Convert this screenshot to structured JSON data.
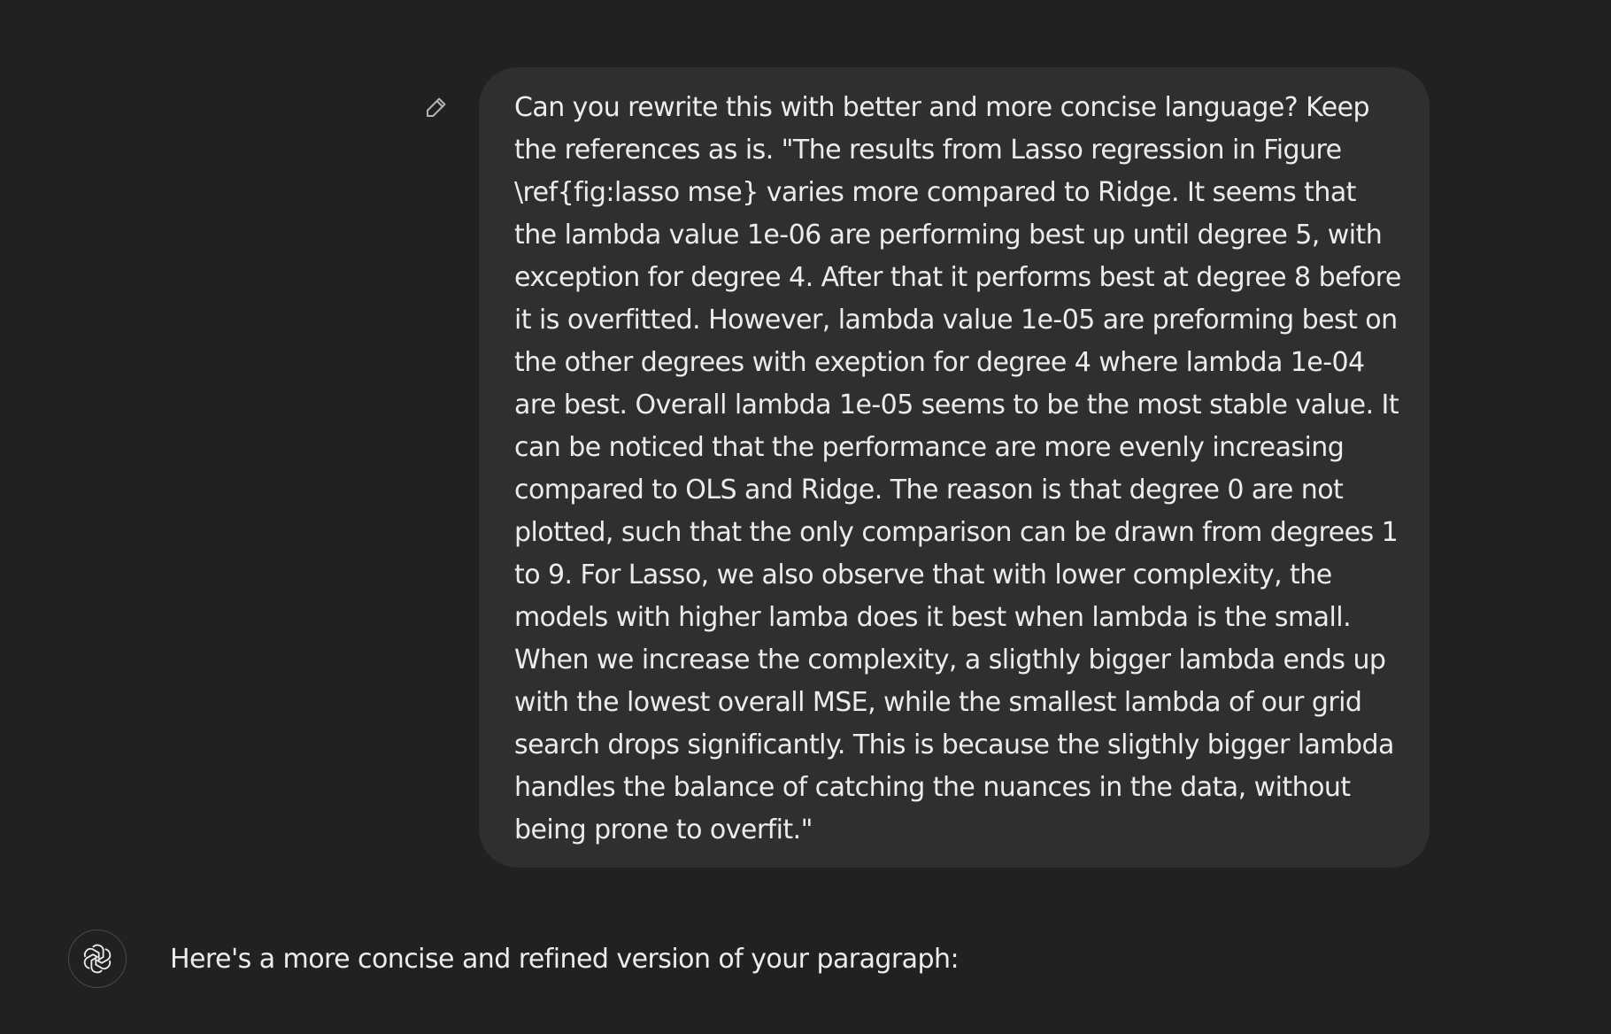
{
  "conversation": {
    "user_message": {
      "text": "Can you rewrite this with better and more concise language? Keep the references as is. \"The results from Lasso regression in Figure \\ref{fig:lasso mse} varies more compared to Ridge. It seems that the lambda value 1e-06 are performing best up until degree 5, with exception for degree 4. After that it performs best at degree 8 before it is overfitted. However, lambda value 1e-05 are preforming best on the other degrees with exeption for degree 4 where lambda 1e-04 are best. Overall lambda 1e-05 seems to be the most stable value. It can be noticed that the performance are more evenly increasing compared to OLS and Ridge. The reason is that degree 0 are not plotted, such that the only comparison can be drawn from degrees 1 to 9. For Lasso, we also observe that with lower complexity, the models with higher lamba does it best when lambda is the small. When we increase the complexity, a sligthly bigger lambda ends up with the lowest overall MSE, while the smallest lambda of our grid search drops significantly. This is because the sligthly bigger lambda handles the balance of catching the nuances in the data, without being prone to overfit.\"",
      "edit_icon": "pencil-icon"
    },
    "assistant_message": {
      "avatar_icon": "openai-logo-icon",
      "text": "Here's a more concise and refined version of your paragraph:"
    }
  },
  "colors": {
    "background": "#212121",
    "user_bubble": "#2f2f2f",
    "text": "#ececec",
    "icon": "#b4b4b4",
    "avatar_border": "#4a4a4a"
  }
}
